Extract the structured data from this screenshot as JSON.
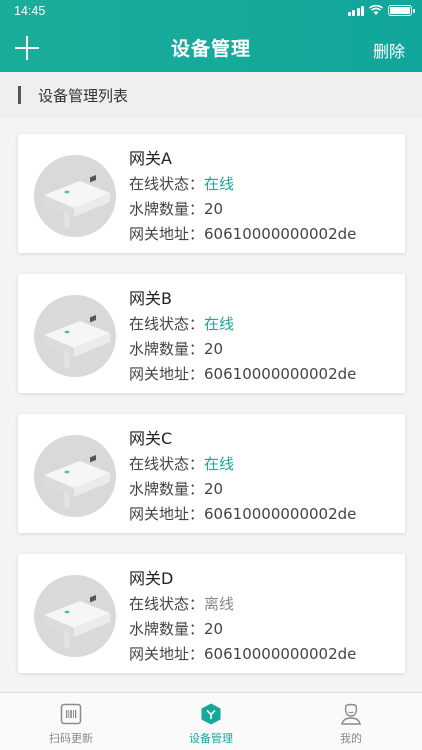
{
  "status_bar": {
    "time": "14:45"
  },
  "header": {
    "title": "设备管理",
    "delete_label": "删除"
  },
  "section": {
    "title": "设备管理列表"
  },
  "labels": {
    "status": "在线状态：",
    "count": "水牌数量：",
    "address": "网关地址："
  },
  "devices": [
    {
      "name": "网关A",
      "status": "在线",
      "count": "20",
      "address": "60610000000002de"
    },
    {
      "name": "网关B",
      "status": "在线",
      "count": "20",
      "address": "60610000000002de"
    },
    {
      "name": "网关C",
      "status": "在线",
      "count": "20",
      "address": "60610000000002de"
    },
    {
      "name": "网关D",
      "status": "离线",
      "count": "20",
      "address": "60610000000002de"
    }
  ],
  "tabs": [
    {
      "label": "扫码更新",
      "icon": "barcode-scan-icon"
    },
    {
      "label": "设备管理",
      "icon": "device-box-icon",
      "active": true
    },
    {
      "label": "我的",
      "icon": "user-profile-icon"
    }
  ],
  "colors": {
    "brand": "#16a99a",
    "online": "#1ba79a",
    "offline": "#888888"
  }
}
